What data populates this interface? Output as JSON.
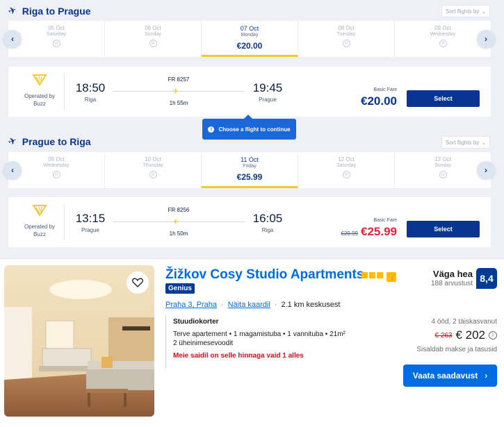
{
  "outbound": {
    "title": "Riga to Prague",
    "sort_label": "Sort flights by",
    "dates": [
      {
        "date": "05 Oct",
        "weekday": "Saturday"
      },
      {
        "date": "06 Oct",
        "weekday": "Sunday"
      },
      {
        "date": "07 Oct",
        "weekday": "Monday",
        "price": "€20.00",
        "selected": true
      },
      {
        "date": "08 Oct",
        "weekday": "Tuesday"
      },
      {
        "date": "09 Oct",
        "weekday": "Wednesday"
      }
    ],
    "flight": {
      "operated_by": "Operated by",
      "operator": "Buzz",
      "dep_time": "18:50",
      "dep_city": "Riga",
      "flight_no": "FR 8257",
      "duration": "1h 55m",
      "arr_time": "19:45",
      "arr_city": "Prague",
      "fare_label": "Basic Fare",
      "fare": "€20.00",
      "select_label": "Select"
    }
  },
  "tooltip": {
    "text": "Choose a flight to continue"
  },
  "inbound": {
    "title": "Prague to Riga",
    "sort_label": "Sort flights by",
    "dates": [
      {
        "date": "09 Oct",
        "weekday": "Wednesday"
      },
      {
        "date": "10 Oct",
        "weekday": "Thursday"
      },
      {
        "date": "11 Oct",
        "weekday": "Friday",
        "price": "€25.99",
        "selected": true
      },
      {
        "date": "12 Oct",
        "weekday": "Saturday"
      },
      {
        "date": "13 Oct",
        "weekday": "Sunday"
      }
    ],
    "flight": {
      "operated_by": "Operated by",
      "operator": "Buzz",
      "dep_time": "13:15",
      "dep_city": "Prague",
      "flight_no": "FR 8256",
      "duration": "1h 50m",
      "arr_time": "16:05",
      "arr_city": "Riga",
      "fare_label": "Basic Fare",
      "old_fare": "€29.99",
      "fare": "€25.99",
      "select_label": "Select"
    }
  },
  "hotel": {
    "name": "Žižkov Cosy Studio Apartments",
    "genius": "Genius",
    "location": "Praha 3, Praha",
    "map_link": "Näita kaardil",
    "distance": "2.1 km keskusest",
    "room_name": "Stuudiokorter",
    "room_desc1": "Terve apartement • 1 magamistuba • 1 vannituba • 21m²",
    "room_desc2": "2 üheinimesevoodit",
    "room_warning": "Meie saidil on selle hinnaga vaid 1 alles",
    "rating_word": "Väga hea",
    "reviews": "188 arvustust",
    "score": "8,4",
    "nights": "4 ööd, 2 täiskasvanut",
    "old_price": "€ 263",
    "price": "€ 202",
    "taxes": "Sisaldab makse ja tasusid",
    "cta": "Vaata saadavust"
  },
  "colors": {
    "ryanair_blue": "#073590",
    "ryanair_yellow": "#f1c933",
    "booking_blue": "#006ce4",
    "fare_red": "#e0243b"
  }
}
